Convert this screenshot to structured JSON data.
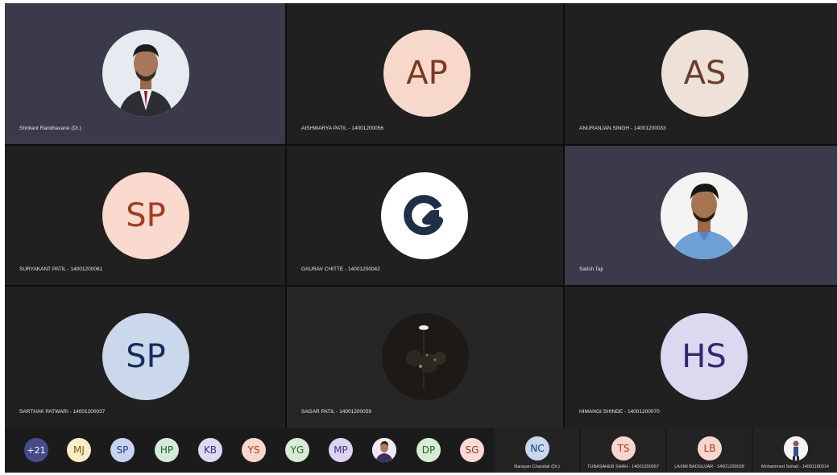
{
  "tiles": [
    {
      "name": "Shrikant Randhavane (Dr.)",
      "avatar_type": "photo",
      "avatar_desc": "man-in-suit"
    },
    {
      "name": "AISHWARYA PATIL - 14001200056",
      "initials": "AP"
    },
    {
      "name": "ANURANJAN SINGH - 14001200033",
      "initials": "AS"
    },
    {
      "name": "SURYAKANT PATIL - 14001200061",
      "initials": "SP"
    },
    {
      "name": "GAURAV CHITTE - 14001200042",
      "avatar_type": "logo"
    },
    {
      "name": "Satish Taji",
      "avatar_type": "photo",
      "avatar_desc": "man-in-blue-shirt"
    },
    {
      "name": "SARTHAK PATWARI - 14001200037",
      "initials": "SP"
    },
    {
      "name": "SAGAR PATIL - 14001200059",
      "avatar_type": "photo",
      "avatar_desc": "night-scene"
    },
    {
      "name": "HIMANGI SHINDE - 14001200070",
      "initials": "HS"
    }
  ],
  "overflow": {
    "more_count": "+21",
    "chips": [
      "MJ",
      "SP",
      "HP",
      "KB",
      "YS",
      "YG",
      "MP",
      "",
      "DP",
      "SG"
    ]
  },
  "strip": [
    {
      "initials": "NC",
      "name": "Narayan Chandak (Dr.)"
    },
    {
      "initials": "TS",
      "name": "TUBASAHEB SHAH - 14001200067"
    },
    {
      "initials": "LB",
      "name": "LAXMI BADGUJAR - 14001200038"
    },
    {
      "initials": "",
      "name": "Mohammed Sohail - 14001180014"
    }
  ],
  "colors": {
    "tile_dark": "#202020",
    "tile_highlight": "#3b3a4a",
    "overflow_bar": "#1b1b1b"
  }
}
